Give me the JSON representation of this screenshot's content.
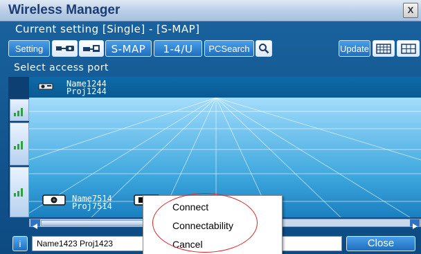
{
  "window": {
    "title": "Wireless Manager",
    "close_glyph": "X"
  },
  "status": {
    "current_setting": "Current setting [Single] - [S-MAP]"
  },
  "toolbar": {
    "setting_label": "Setting",
    "smap_label": "S-MAP",
    "page_label": "1-4/U",
    "pcsearch_label": "PCSearch",
    "update_label": "Update",
    "icons": [
      "projector-connect-icon",
      "network-connect-icon",
      "search-icon",
      "keyboard-view-icon",
      "grid-view-icon"
    ]
  },
  "map": {
    "prompt": "Select access port",
    "devices": [
      {
        "name": "Name1244",
        "proj": "Proj1244"
      },
      {
        "name": "Name7514",
        "proj": "Proj7514"
      }
    ],
    "signal_icon": "signal-strength-icon"
  },
  "bottom": {
    "info_glyph": "i",
    "info_value": "Name1423 Proj1423",
    "close_label": "Close"
  },
  "context_menu": {
    "items": [
      "Connect",
      "Connectability",
      "Cancel"
    ]
  },
  "colors": {
    "window_bg": "#1a64a0",
    "title_text": "#1b3d73",
    "highlight_ellipse": "#e02020"
  }
}
